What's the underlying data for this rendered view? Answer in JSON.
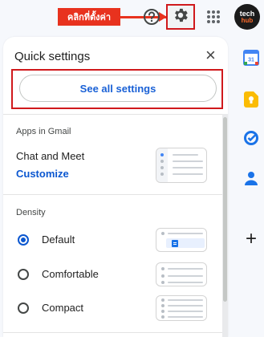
{
  "annotation": {
    "label": "คลิกที่ตั้งค่า",
    "color": "#e8321e"
  },
  "header": {
    "help_icon": "help-icon",
    "settings_icon": "gear-icon",
    "apps_icon": "apps-grid-icon",
    "avatar_line1": "tech",
    "avatar_line2": "hub"
  },
  "panel": {
    "title": "Quick settings",
    "close_label": "×",
    "see_all_label": "See all settings",
    "apps_section": {
      "heading": "Apps in Gmail",
      "item": "Chat and Meet",
      "customize": "Customize"
    },
    "density_section": {
      "heading": "Density",
      "options": [
        {
          "label": "Default",
          "selected": true
        },
        {
          "label": "Comfortable",
          "selected": false
        },
        {
          "label": "Compact",
          "selected": false
        }
      ]
    }
  },
  "side_rail": {
    "icons": [
      "calendar-icon",
      "keep-icon",
      "tasks-icon",
      "contacts-icon",
      "add-icon"
    ],
    "add_label": "+"
  },
  "colors": {
    "accent": "#0b57d0",
    "annotation_red": "#d0191c",
    "background": "#f6f8fc"
  }
}
